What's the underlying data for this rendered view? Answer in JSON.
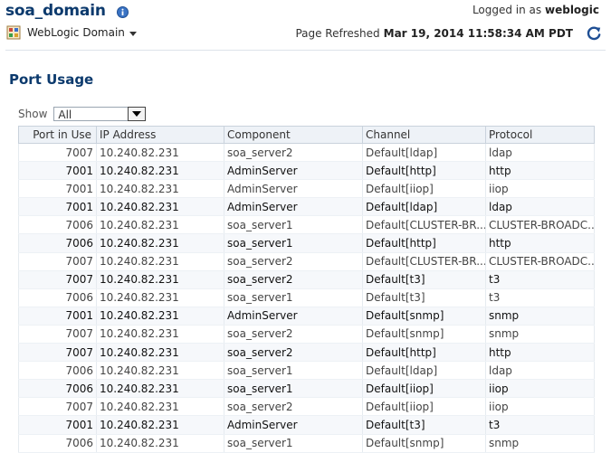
{
  "header": {
    "title": "soa_domain",
    "logged_in_label": "Logged in as",
    "username": "weblogic",
    "domain_menu_label": "WebLogic Domain",
    "refreshed_label": "Page Refreshed",
    "refreshed_time": "Mar 19, 2014 11:58:34 AM PDT"
  },
  "icons": {
    "info": "info-icon",
    "domain": "weblogic-domain-icon",
    "refresh": "refresh-icon",
    "dropdown": "chevron-down-icon"
  },
  "colors": {
    "title": "#0c3a6d",
    "header_bg": "#eef2f7",
    "border": "#c9d2dc"
  },
  "section": {
    "title": "Port Usage"
  },
  "filter": {
    "label": "Show",
    "value": "All"
  },
  "table": {
    "columns": [
      "Port in Use",
      "IP Address",
      "Component",
      "Channel",
      "Protocol"
    ],
    "rows": [
      [
        "7007",
        "10.240.82.231",
        "soa_server2",
        "Default[ldap]",
        "ldap"
      ],
      [
        "7001",
        "10.240.82.231",
        "AdminServer",
        "Default[http]",
        "http"
      ],
      [
        "7001",
        "10.240.82.231",
        "AdminServer",
        "Default[iiop]",
        "iiop"
      ],
      [
        "7001",
        "10.240.82.231",
        "AdminServer",
        "Default[ldap]",
        "ldap"
      ],
      [
        "7006",
        "10.240.82.231",
        "soa_server1",
        "Default[CLUSTER-BR...",
        "CLUSTER-BROADC..."
      ],
      [
        "7006",
        "10.240.82.231",
        "soa_server1",
        "Default[http]",
        "http"
      ],
      [
        "7007",
        "10.240.82.231",
        "soa_server2",
        "Default[CLUSTER-BR...",
        "CLUSTER-BROADC..."
      ],
      [
        "7007",
        "10.240.82.231",
        "soa_server2",
        "Default[t3]",
        "t3"
      ],
      [
        "7006",
        "10.240.82.231",
        "soa_server1",
        "Default[t3]",
        "t3"
      ],
      [
        "7001",
        "10.240.82.231",
        "AdminServer",
        "Default[snmp]",
        "snmp"
      ],
      [
        "7007",
        "10.240.82.231",
        "soa_server2",
        "Default[snmp]",
        "snmp"
      ],
      [
        "7007",
        "10.240.82.231",
        "soa_server2",
        "Default[http]",
        "http"
      ],
      [
        "7006",
        "10.240.82.231",
        "soa_server1",
        "Default[ldap]",
        "ldap"
      ],
      [
        "7006",
        "10.240.82.231",
        "soa_server1",
        "Default[iiop]",
        "iiop"
      ],
      [
        "7007",
        "10.240.82.231",
        "soa_server2",
        "Default[iiop]",
        "iiop"
      ],
      [
        "7001",
        "10.240.82.231",
        "AdminServer",
        "Default[t3]",
        "t3"
      ],
      [
        "7006",
        "10.240.82.231",
        "soa_server1",
        "Default[snmp]",
        "snmp"
      ]
    ]
  }
}
